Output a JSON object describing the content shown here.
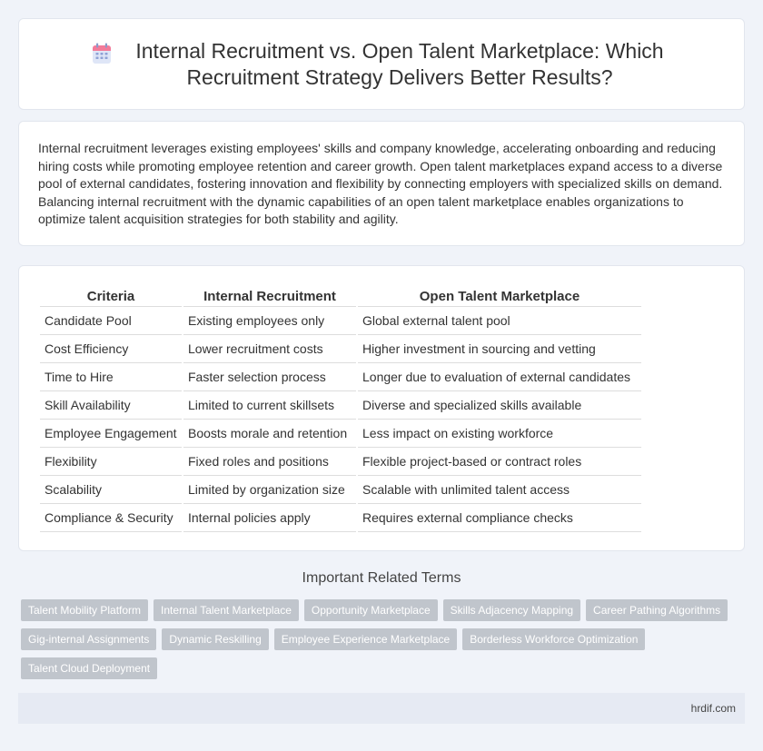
{
  "header": {
    "title": "Internal Recruitment vs. Open Talent Marketplace: Which Recruitment Strategy Delivers Better Results?",
    "icon": "calendar-icon"
  },
  "intro": {
    "text": "Internal recruitment leverages existing employees' skills and company knowledge, accelerating onboarding and reducing hiring costs while promoting employee retention and career growth. Open talent marketplaces expand access to a diverse pool of external candidates, fostering innovation and flexibility by connecting employers with specialized skills on demand. Balancing internal recruitment with the dynamic capabilities of an open talent marketplace enables organizations to optimize talent acquisition strategies for both stability and agility."
  },
  "table": {
    "headers": [
      "Criteria",
      "Internal Recruitment",
      "Open Talent Marketplace"
    ],
    "rows": [
      [
        "Candidate Pool",
        "Existing employees only",
        "Global external talent pool"
      ],
      [
        "Cost Efficiency",
        "Lower recruitment costs",
        "Higher investment in sourcing and vetting"
      ],
      [
        "Time to Hire",
        "Faster selection process",
        "Longer due to evaluation of external candidates"
      ],
      [
        "Skill Availability",
        "Limited to current skillsets",
        "Diverse and specialized skills available"
      ],
      [
        "Employee Engagement",
        "Boosts morale and retention",
        "Less impact on existing workforce"
      ],
      [
        "Flexibility",
        "Fixed roles and positions",
        "Flexible project-based or contract roles"
      ],
      [
        "Scalability",
        "Limited by organization size",
        "Scalable with unlimited talent access"
      ],
      [
        "Compliance & Security",
        "Internal policies apply",
        "Requires external compliance checks"
      ]
    ]
  },
  "related": {
    "heading": "Important Related Terms",
    "tags": [
      "Talent Mobility Platform",
      "Internal Talent Marketplace",
      "Opportunity Marketplace",
      "Skills Adjacency Mapping",
      "Career Pathing Algorithms",
      "Gig-internal Assignments",
      "Dynamic Reskilling",
      "Employee Experience Marketplace",
      "Borderless Workforce Optimization",
      "Talent Cloud Deployment"
    ]
  },
  "footer": {
    "site": "hrdif.com"
  },
  "colors": {
    "background": "#f0f3f9",
    "card": "#ffffff",
    "tag": "#c0c5cc",
    "footer": "#e6eaf3"
  }
}
